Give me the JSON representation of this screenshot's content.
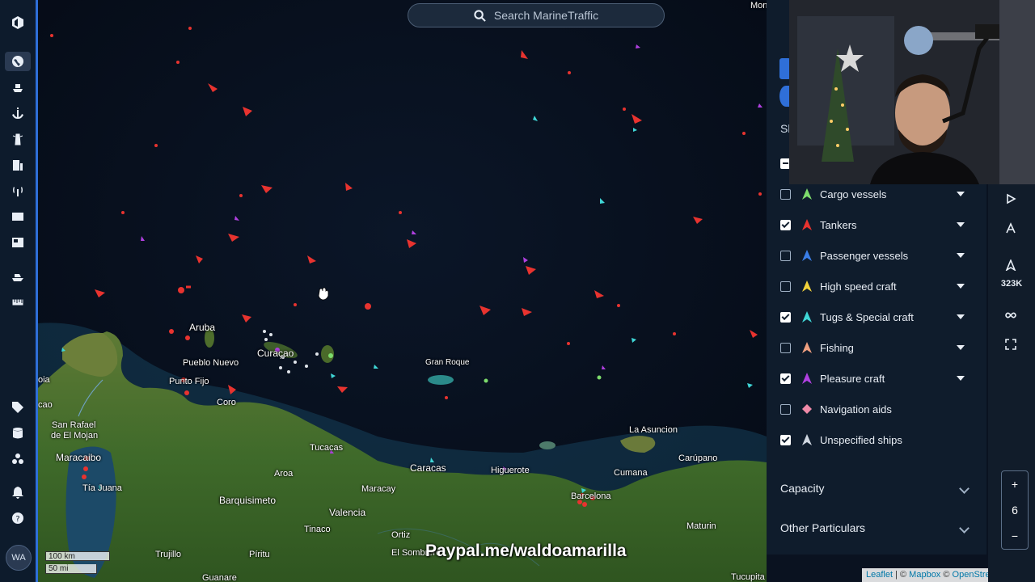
{
  "search": {
    "placeholder": "Search MarineTraffic"
  },
  "rail": {
    "avatar": "WA"
  },
  "map": {
    "places": [
      {
        "name": "Aruba"
      },
      {
        "name": "Pueblo Nuevo"
      },
      {
        "name": "Punto Fijo"
      },
      {
        "name": "Coro"
      },
      {
        "name": "Curaçao"
      },
      {
        "name": "Gran Roque"
      },
      {
        "name": "San Rafael"
      },
      {
        "name": "de El Mojan"
      },
      {
        "name": "Maracaibo"
      },
      {
        "name": "Tía Juana"
      },
      {
        "name": "Tucacas"
      },
      {
        "name": "Aroa"
      },
      {
        "name": "Caracas"
      },
      {
        "name": "Higuerote"
      },
      {
        "name": "Maracay"
      },
      {
        "name": "Barquisimeto"
      },
      {
        "name": "Valencia"
      },
      {
        "name": "Tinaco"
      },
      {
        "name": "Ortiz"
      },
      {
        "name": "El Sombrero"
      },
      {
        "name": "Trujillo"
      },
      {
        "name": "Píritu"
      },
      {
        "name": "Guanare"
      },
      {
        "name": "La Asuncion"
      },
      {
        "name": "Carúpano"
      },
      {
        "name": "Cumana"
      },
      {
        "name": "Barcelona"
      },
      {
        "name": "Maturin"
      },
      {
        "name": "Tucupita"
      },
      {
        "name": "Monc"
      },
      {
        "name": "oia"
      },
      {
        "name": "cao"
      }
    ],
    "scale": {
      "km": "100 km",
      "mi": "50 mi"
    },
    "overlay_text": "Paypal.me/waldoamarilla",
    "attribution": {
      "leaflet": "Leaflet",
      "sep": " | © ",
      "mapbox": "Mapbox",
      "sep2": " © ",
      "osm": "OpenStreetMap"
    }
  },
  "panel": {
    "fragment_sh": "Sh",
    "vessel_types": [
      {
        "label": "Cargo vessels",
        "checked": false,
        "color": "#7ddc6c"
      },
      {
        "label": "Tankers",
        "checked": true,
        "color": "#e8332f"
      },
      {
        "label": "Passenger vessels",
        "checked": false,
        "color": "#3a7ee8"
      },
      {
        "label": "High speed craft",
        "checked": false,
        "color": "#f2d23a"
      },
      {
        "label": "Tugs & Special craft",
        "checked": true,
        "color": "#3fd6d6"
      },
      {
        "label": "Fishing",
        "checked": false,
        "color": "#f0a080"
      },
      {
        "label": "Pleasure craft",
        "checked": true,
        "color": "#b040e0"
      },
      {
        "label": "Navigation aids",
        "checked": false,
        "color": "#f08aa8"
      },
      {
        "label": "Unspecified ships",
        "checked": true,
        "color": "#cfd6e0"
      }
    ],
    "sections": {
      "capacity": "Capacity",
      "other": "Other Particulars"
    }
  },
  "tools": {
    "count": "323K",
    "zoom_in": "+",
    "zoom_level": "6",
    "zoom_out": "−"
  }
}
